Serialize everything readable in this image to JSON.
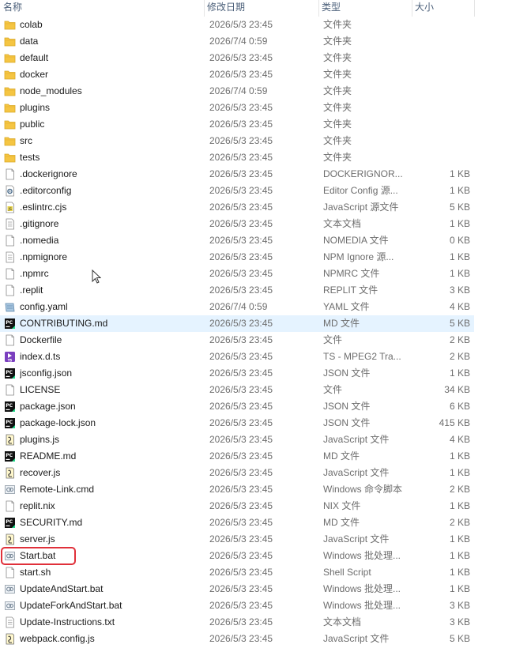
{
  "columns": {
    "name": "名称",
    "date": "修改日期",
    "type": "类型",
    "size": "大小"
  },
  "colors": {
    "folder": "#f5c542",
    "highlight": "#e0303a",
    "hover_row": "#e5f3ff"
  },
  "files": [
    {
      "name": "colab",
      "date": "2026/5/3 23:45",
      "type": "文件夹",
      "size": "",
      "icon": "folder-icon"
    },
    {
      "name": "data",
      "date": "2026/7/4 0:59",
      "type": "文件夹",
      "size": "",
      "icon": "folder-icon"
    },
    {
      "name": "default",
      "date": "2026/5/3 23:45",
      "type": "文件夹",
      "size": "",
      "icon": "folder-icon"
    },
    {
      "name": "docker",
      "date": "2026/5/3 23:45",
      "type": "文件夹",
      "size": "",
      "icon": "folder-icon"
    },
    {
      "name": "node_modules",
      "date": "2026/7/4 0:59",
      "type": "文件夹",
      "size": "",
      "icon": "folder-icon"
    },
    {
      "name": "plugins",
      "date": "2026/5/3 23:45",
      "type": "文件夹",
      "size": "",
      "icon": "folder-icon"
    },
    {
      "name": "public",
      "date": "2026/5/3 23:45",
      "type": "文件夹",
      "size": "",
      "icon": "folder-icon"
    },
    {
      "name": "src",
      "date": "2026/5/3 23:45",
      "type": "文件夹",
      "size": "",
      "icon": "folder-icon"
    },
    {
      "name": "tests",
      "date": "2026/5/3 23:45",
      "type": "文件夹",
      "size": "",
      "icon": "folder-icon"
    },
    {
      "name": ".dockerignore",
      "date": "2026/5/3 23:45",
      "type": "DOCKERIGNOR...",
      "size": "1 KB",
      "icon": "blank-file-icon"
    },
    {
      "name": ".editorconfig",
      "date": "2026/5/3 23:45",
      "type": "Editor Config 源...",
      "size": "1 KB",
      "icon": "gear-file-icon"
    },
    {
      "name": ".eslintrc.cjs",
      "date": "2026/5/3 23:45",
      "type": "JavaScript 源文件",
      "size": "5 KB",
      "icon": "js-file-icon"
    },
    {
      "name": ".gitignore",
      "date": "2026/5/3 23:45",
      "type": "文本文档",
      "size": "1 KB",
      "icon": "text-file-icon"
    },
    {
      "name": ".nomedia",
      "date": "2026/5/3 23:45",
      "type": "NOMEDIA 文件",
      "size": "0 KB",
      "icon": "blank-file-icon"
    },
    {
      "name": ".npmignore",
      "date": "2026/5/3 23:45",
      "type": "NPM Ignore 源...",
      "size": "1 KB",
      "icon": "text-file-icon"
    },
    {
      "name": ".npmrc",
      "date": "2026/5/3 23:45",
      "type": "NPMRC 文件",
      "size": "1 KB",
      "icon": "blank-file-icon"
    },
    {
      "name": ".replit",
      "date": "2026/5/3 23:45",
      "type": "REPLIT 文件",
      "size": "3 KB",
      "icon": "blank-file-icon"
    },
    {
      "name": "config.yaml",
      "date": "2026/7/4 0:59",
      "type": "YAML 文件",
      "size": "4 KB",
      "icon": "yaml-file-icon"
    },
    {
      "name": "CONTRIBUTING.md",
      "date": "2026/5/3 23:45",
      "type": "MD 文件",
      "size": "5 KB",
      "icon": "pycharm-file-icon"
    },
    {
      "name": "Dockerfile",
      "date": "2026/5/3 23:45",
      "type": "文件",
      "size": "2 KB",
      "icon": "blank-file-icon"
    },
    {
      "name": "index.d.ts",
      "date": "2026/5/3 23:45",
      "type": "TS - MPEG2 Tra...",
      "size": "2 KB",
      "icon": "ts-file-icon"
    },
    {
      "name": "jsconfig.json",
      "date": "2026/5/3 23:45",
      "type": "JSON 文件",
      "size": "1 KB",
      "icon": "pycharm-file-icon"
    },
    {
      "name": "LICENSE",
      "date": "2026/5/3 23:45",
      "type": "文件",
      "size": "34 KB",
      "icon": "blank-file-icon"
    },
    {
      "name": "package.json",
      "date": "2026/5/3 23:45",
      "type": "JSON 文件",
      "size": "6 KB",
      "icon": "pycharm-file-icon"
    },
    {
      "name": "package-lock.json",
      "date": "2026/5/3 23:45",
      "type": "JSON 文件",
      "size": "415 KB",
      "icon": "pycharm-file-icon"
    },
    {
      "name": "plugins.js",
      "date": "2026/5/3 23:45",
      "type": "JavaScript 文件",
      "size": "4 KB",
      "icon": "script-file-icon"
    },
    {
      "name": "README.md",
      "date": "2026/5/3 23:45",
      "type": "MD 文件",
      "size": "1 KB",
      "icon": "pycharm-file-icon"
    },
    {
      "name": "recover.js",
      "date": "2026/5/3 23:45",
      "type": "JavaScript 文件",
      "size": "1 KB",
      "icon": "script-file-icon"
    },
    {
      "name": "Remote-Link.cmd",
      "date": "2026/5/3 23:45",
      "type": "Windows 命令脚本",
      "size": "2 KB",
      "icon": "cmd-file-icon"
    },
    {
      "name": "replit.nix",
      "date": "2026/5/3 23:45",
      "type": "NIX 文件",
      "size": "1 KB",
      "icon": "blank-file-icon"
    },
    {
      "name": "SECURITY.md",
      "date": "2026/5/3 23:45",
      "type": "MD 文件",
      "size": "2 KB",
      "icon": "pycharm-file-icon"
    },
    {
      "name": "server.js",
      "date": "2026/5/3 23:45",
      "type": "JavaScript 文件",
      "size": "1 KB",
      "icon": "script-file-icon"
    },
    {
      "name": "Start.bat",
      "date": "2026/5/3 23:45",
      "type": "Windows 批处理...",
      "size": "1 KB",
      "icon": "cmd-file-icon"
    },
    {
      "name": "start.sh",
      "date": "2026/5/3 23:45",
      "type": "Shell Script",
      "size": "1 KB",
      "icon": "blank-file-icon"
    },
    {
      "name": "UpdateAndStart.bat",
      "date": "2026/5/3 23:45",
      "type": "Windows 批处理...",
      "size": "1 KB",
      "icon": "cmd-file-icon"
    },
    {
      "name": "UpdateForkAndStart.bat",
      "date": "2026/5/3 23:45",
      "type": "Windows 批处理...",
      "size": "3 KB",
      "icon": "cmd-file-icon"
    },
    {
      "name": "Update-Instructions.txt",
      "date": "2026/5/3 23:45",
      "type": "文本文档",
      "size": "3 KB",
      "icon": "text-file-icon"
    },
    {
      "name": "webpack.config.js",
      "date": "2026/5/3 23:45",
      "type": "JavaScript 文件",
      "size": "5 KB",
      "icon": "script-file-icon"
    }
  ]
}
